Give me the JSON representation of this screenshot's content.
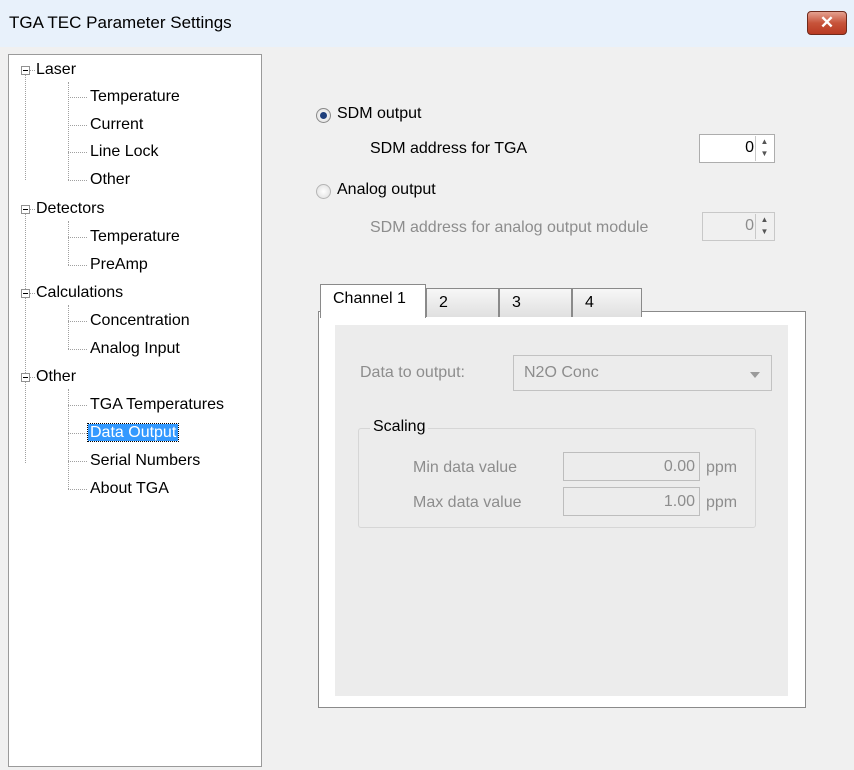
{
  "window": {
    "title": "TGA TEC Parameter Settings",
    "close_glyph": "✕"
  },
  "tree": {
    "groups": [
      {
        "label": "Laser",
        "children": [
          "Temperature",
          "Current",
          "Line Lock",
          "Other"
        ]
      },
      {
        "label": "Detectors",
        "children": [
          "Temperature",
          "PreAmp"
        ]
      },
      {
        "label": "Calculations",
        "children": [
          "Concentration",
          "Analog Input"
        ]
      },
      {
        "label": "Other",
        "children": [
          "TGA Temperatures",
          "Data Output",
          "Serial Numbers",
          "About TGA"
        ]
      }
    ],
    "selected": "Data Output"
  },
  "output": {
    "sdm_label": "SDM output",
    "sdm_address_label": "SDM address for TGA",
    "sdm_address_value": "0",
    "analog_label": "Analog output",
    "analog_address_label": "SDM address for analog output module",
    "analog_address_value": "0",
    "selected": "SDM output"
  },
  "tabs": [
    "Channel 1",
    "2",
    "3",
    "4"
  ],
  "channel": {
    "data_label": "Data to output:",
    "data_value": "N2O Conc",
    "scaling_title": "Scaling",
    "min_label": "Min data value",
    "min_value": "0.00",
    "max_label": "Max data value",
    "max_value": "1.00",
    "unit": "ppm"
  },
  "colors": {
    "selection": "#3399ff",
    "close_button": "#c7533a",
    "disabled_text": "#8d8d8d"
  }
}
